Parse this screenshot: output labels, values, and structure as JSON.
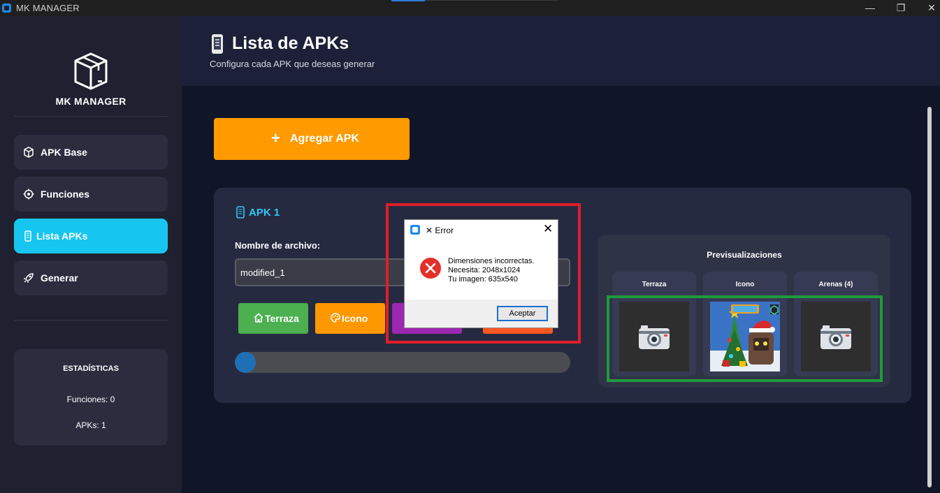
{
  "window": {
    "title": "MK MANAGER",
    "minimize": "—",
    "maximize": "❐",
    "close": "✕"
  },
  "sidebar": {
    "brand": "MK MANAGER",
    "items": [
      {
        "label": "APK Base",
        "icon": "box-icon",
        "active": false
      },
      {
        "label": "Funciones",
        "icon": "gear-icon",
        "active": false
      },
      {
        "label": "Lista APKs",
        "icon": "phone-icon",
        "active": true
      },
      {
        "label": "Generar",
        "icon": "rocket-icon",
        "active": false
      }
    ],
    "stats": {
      "title": "ESTADÍSTICAS",
      "funciones": "Funciones: 0",
      "apks": "APKs: 1"
    }
  },
  "header": {
    "title": "Lista de APKs",
    "subtitle": "Configura cada APK que deseas generar"
  },
  "main": {
    "add_button": {
      "plus": "+",
      "label": "Agregar APK"
    },
    "apk_card": {
      "title": "APK 1",
      "filename_label": "Nombre de archivo:",
      "filename_value": "modified_1",
      "buttons": [
        {
          "label": "Terraza",
          "color": "#4caf50"
        },
        {
          "label": "Icono",
          "color": "#ff9800"
        },
        {
          "label": "",
          "color": "#9c27b0"
        },
        {
          "label": "",
          "color": "#ff5722"
        }
      ],
      "progress": 0.06
    },
    "preview": {
      "title": "Previsualizaciones",
      "columns": [
        {
          "label": "Terraza",
          "content": "camera-placeholder"
        },
        {
          "label": "Icono",
          "content": "game-icon-image"
        },
        {
          "label": "Arenas (4)",
          "content": "camera-placeholder"
        }
      ]
    }
  },
  "dialog": {
    "title": "Error",
    "title_prefix": "✕",
    "close": "✕",
    "line1": "Dimensiones incorrectas.",
    "line2": "Necesita: 2048x1024",
    "line3": "Tu imagen: 635x540",
    "ok_label": "Aceptar"
  },
  "colors": {
    "accent": "#17c6f0",
    "add_button": "#ff9b00",
    "highlight_red": "#e01e2a",
    "highlight_green": "#1f9a3d"
  }
}
